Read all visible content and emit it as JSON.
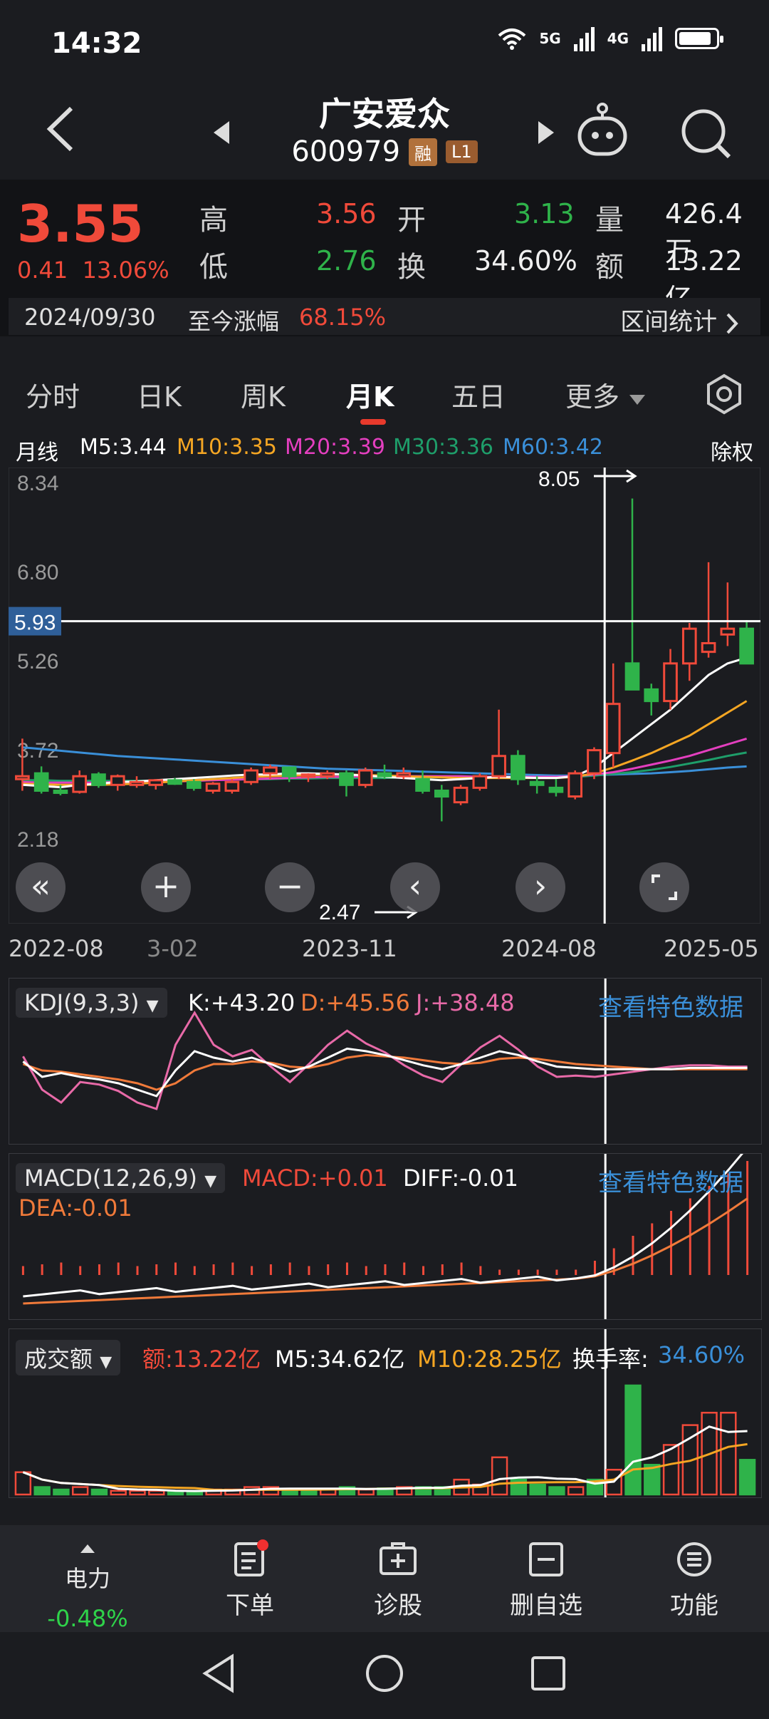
{
  "status": {
    "time": "14:32",
    "net1": "5G",
    "net2": "4G"
  },
  "header": {
    "name": "广安爱众",
    "code": "600979",
    "tag1": "融",
    "tag2": "L1"
  },
  "quote": {
    "price": "3.55",
    "change": "0.41",
    "change_pct": "13.06%",
    "high_label": "高",
    "high": "3.56",
    "low_label": "低",
    "low": "2.76",
    "open_label": "开",
    "open": "3.13",
    "turnover_label": "换",
    "turnover": "34.60%",
    "volume_label": "量",
    "volume": "426.4万",
    "amount_label": "额",
    "amount": "13.22亿",
    "date": "2024/09/30",
    "ytd_label": "至今涨幅",
    "ytd": "68.15%",
    "interval_label": "区间统计"
  },
  "tabs": [
    "分时",
    "日K",
    "周K",
    "月K",
    "五日",
    "更多"
  ],
  "ma": {
    "label": "月线",
    "m5": "M5:3.44",
    "m10": "M10:3.35",
    "m20": "M20:3.39",
    "m30": "M30:3.36",
    "m60": "M60:3.42",
    "fq": "除权"
  },
  "colors": {
    "up": "#f04a3a",
    "down": "#2fb34a",
    "m5": "#ffffff",
    "m10": "#f5a623",
    "m20": "#e43fbf",
    "m30": "#1e9e6a",
    "m60": "#3a8fd8"
  },
  "chart_data": {
    "type": "candlestick",
    "y_ticks": [
      "8.34",
      "6.80",
      "5.26",
      "3.72",
      "2.18"
    ],
    "ylim": [
      2.18,
      8.34
    ],
    "x_ticks": [
      "2022-08",
      "3-02",
      "2023-11",
      "2024-08",
      "2025-05"
    ],
    "crosshair_price": "5.93",
    "max_label": "8.05",
    "min_label": "2.47",
    "candles": [
      {
        "o": 3.2,
        "h": 3.9,
        "l": 3.0,
        "c": 3.25
      },
      {
        "o": 3.3,
        "h": 3.42,
        "l": 2.95,
        "c": 3.0
      },
      {
        "o": 3.0,
        "h": 3.1,
        "l": 2.92,
        "c": 2.97
      },
      {
        "o": 2.98,
        "h": 3.35,
        "l": 2.95,
        "c": 3.25
      },
      {
        "o": 3.28,
        "h": 3.32,
        "l": 3.05,
        "c": 3.1
      },
      {
        "o": 3.1,
        "h": 3.28,
        "l": 3.0,
        "c": 3.25
      },
      {
        "o": 3.1,
        "h": 3.25,
        "l": 3.05,
        "c": 3.15
      },
      {
        "o": 3.1,
        "h": 3.2,
        "l": 3.02,
        "c": 3.18
      },
      {
        "o": 3.18,
        "h": 3.22,
        "l": 3.1,
        "c": 3.12
      },
      {
        "o": 3.15,
        "h": 3.2,
        "l": 3.0,
        "c": 3.05
      },
      {
        "o": 3.0,
        "h": 3.15,
        "l": 2.95,
        "c": 3.12
      },
      {
        "o": 3.0,
        "h": 3.2,
        "l": 2.95,
        "c": 3.15
      },
      {
        "o": 3.15,
        "h": 3.4,
        "l": 3.1,
        "c": 3.35
      },
      {
        "o": 3.3,
        "h": 3.45,
        "l": 3.2,
        "c": 3.4
      },
      {
        "o": 3.4,
        "h": 3.42,
        "l": 3.15,
        "c": 3.25
      },
      {
        "o": 3.25,
        "h": 3.3,
        "l": 3.15,
        "c": 3.28
      },
      {
        "o": 3.25,
        "h": 3.35,
        "l": 3.2,
        "c": 3.3
      },
      {
        "o": 3.3,
        "h": 3.35,
        "l": 2.9,
        "c": 3.1
      },
      {
        "o": 3.1,
        "h": 3.4,
        "l": 3.05,
        "c": 3.35
      },
      {
        "o": 3.3,
        "h": 3.45,
        "l": 3.2,
        "c": 3.25
      },
      {
        "o": 3.25,
        "h": 3.4,
        "l": 3.2,
        "c": 3.3
      },
      {
        "o": 3.2,
        "h": 3.35,
        "l": 2.95,
        "c": 3.0
      },
      {
        "o": 3.0,
        "h": 3.1,
        "l": 2.47,
        "c": 2.9
      },
      {
        "o": 2.8,
        "h": 3.1,
        "l": 2.75,
        "c": 3.05
      },
      {
        "o": 3.05,
        "h": 3.3,
        "l": 3.0,
        "c": 3.25
      },
      {
        "o": 3.25,
        "h": 4.4,
        "l": 3.2,
        "c": 3.6
      },
      {
        "o": 3.6,
        "h": 3.7,
        "l": 3.1,
        "c": 3.2
      },
      {
        "o": 3.15,
        "h": 3.25,
        "l": 2.95,
        "c": 3.1
      },
      {
        "o": 3.05,
        "h": 3.2,
        "l": 2.9,
        "c": 2.98
      },
      {
        "o": 2.9,
        "h": 3.35,
        "l": 2.85,
        "c": 3.3
      },
      {
        "o": 3.3,
        "h": 3.75,
        "l": 3.2,
        "c": 3.7
      },
      {
        "o": 3.65,
        "h": 5.2,
        "l": 3.4,
        "c": 4.5
      },
      {
        "o": 5.2,
        "h": 8.05,
        "l": 4.8,
        "c": 4.75
      },
      {
        "o": 4.75,
        "h": 4.85,
        "l": 4.3,
        "c": 4.55
      },
      {
        "o": 4.55,
        "h": 5.45,
        "l": 4.4,
        "c": 5.2
      },
      {
        "o": 5.2,
        "h": 5.9,
        "l": 4.9,
        "c": 5.8
      },
      {
        "o": 5.4,
        "h": 6.95,
        "l": 5.3,
        "c": 5.55
      },
      {
        "o": 5.7,
        "h": 6.6,
        "l": 5.5,
        "c": 5.8
      },
      {
        "o": 5.8,
        "h": 5.95,
        "l": 5.2,
        "c": 5.2
      }
    ],
    "ma": {
      "m5": [
        3.1,
        3.08,
        3.06,
        3.1,
        3.12,
        3.15,
        3.16,
        3.18,
        3.2,
        3.22,
        3.24,
        3.26,
        3.28,
        3.28,
        3.3,
        3.3,
        3.29,
        3.28,
        3.26,
        3.24,
        3.22,
        3.2,
        3.18,
        3.2,
        3.22,
        3.24,
        3.23,
        3.22,
        3.22,
        3.25,
        3.4,
        3.65,
        3.9,
        4.15,
        4.4,
        4.7,
        5.0,
        5.2,
        5.3
      ],
      "m10": [
        3.12,
        3.11,
        3.1,
        3.1,
        3.1,
        3.11,
        3.12,
        3.14,
        3.16,
        3.18,
        3.2,
        3.22,
        3.24,
        3.25,
        3.26,
        3.27,
        3.28,
        3.28,
        3.27,
        3.26,
        3.25,
        3.24,
        3.23,
        3.22,
        3.22,
        3.22,
        3.22,
        3.22,
        3.22,
        3.24,
        3.3,
        3.4,
        3.52,
        3.65,
        3.8,
        3.95,
        4.15,
        4.35,
        4.55
      ],
      "m20": [
        3.15,
        3.14,
        3.14,
        3.14,
        3.14,
        3.15,
        3.15,
        3.16,
        3.16,
        3.17,
        3.18,
        3.19,
        3.2,
        3.21,
        3.22,
        3.23,
        3.24,
        3.24,
        3.25,
        3.25,
        3.25,
        3.25,
        3.25,
        3.25,
        3.24,
        3.24,
        3.24,
        3.24,
        3.24,
        3.25,
        3.28,
        3.32,
        3.38,
        3.45,
        3.52,
        3.6,
        3.7,
        3.8,
        3.9
      ],
      "m30": [
        3.18,
        3.18,
        3.17,
        3.17,
        3.17,
        3.17,
        3.17,
        3.17,
        3.18,
        3.18,
        3.19,
        3.19,
        3.2,
        3.2,
        3.21,
        3.21,
        3.22,
        3.22,
        3.22,
        3.22,
        3.23,
        3.23,
        3.23,
        3.23,
        3.23,
        3.23,
        3.23,
        3.23,
        3.23,
        3.24,
        3.26,
        3.29,
        3.32,
        3.36,
        3.41,
        3.47,
        3.53,
        3.6,
        3.66
      ],
      "m60": [
        3.75,
        3.72,
        3.69,
        3.66,
        3.63,
        3.6,
        3.58,
        3.56,
        3.54,
        3.52,
        3.5,
        3.48,
        3.46,
        3.44,
        3.42,
        3.4,
        3.38,
        3.37,
        3.36,
        3.35,
        3.34,
        3.33,
        3.32,
        3.31,
        3.3,
        3.29,
        3.28,
        3.27,
        3.26,
        3.26,
        3.27,
        3.28,
        3.29,
        3.3,
        3.32,
        3.34,
        3.37,
        3.4,
        3.42
      ]
    },
    "kdj": {
      "k": [
        52,
        40,
        43,
        40,
        38,
        35,
        30,
        25,
        45,
        60,
        55,
        52,
        55,
        50,
        44,
        48,
        55,
        62,
        60,
        57,
        53,
        49,
        46,
        50,
        55,
        60,
        57,
        52,
        48,
        47,
        46,
        46,
        46,
        46,
        46,
        47,
        47,
        47,
        47
      ],
      "d": [
        50,
        45,
        44,
        42,
        40,
        38,
        35,
        30,
        35,
        45,
        50,
        50,
        52,
        51,
        48,
        47,
        50,
        55,
        57,
        56,
        55,
        53,
        51,
        50,
        51,
        54,
        55,
        54,
        52,
        50,
        49,
        48,
        47,
        46,
        46,
        46,
        46,
        46,
        46
      ],
      "j": [
        56,
        30,
        20,
        36,
        34,
        29,
        20,
        15,
        65,
        90,
        65,
        56,
        61,
        48,
        36,
        50,
        65,
        76,
        66,
        59,
        49,
        41,
        36,
        50,
        63,
        72,
        61,
        48,
        40,
        41,
        40,
        42,
        44,
        46,
        48,
        49,
        49,
        48,
        48
      ]
    },
    "volume": [
      {
        "v": 0.9,
        "up": true
      },
      {
        "v": 0.3,
        "up": false
      },
      {
        "v": 0.2,
        "up": false
      },
      {
        "v": 0.3,
        "up": true
      },
      {
        "v": 0.2,
        "up": false
      },
      {
        "v": 0.15,
        "up": true
      },
      {
        "v": 0.15,
        "up": true
      },
      {
        "v": 0.15,
        "up": true
      },
      {
        "v": 0.1,
        "up": false
      },
      {
        "v": 0.15,
        "up": false
      },
      {
        "v": 0.2,
        "up": true
      },
      {
        "v": 0.2,
        "up": true
      },
      {
        "v": 0.3,
        "up": true
      },
      {
        "v": 0.3,
        "up": true
      },
      {
        "v": 0.2,
        "up": false
      },
      {
        "v": 0.2,
        "up": false
      },
      {
        "v": 0.2,
        "up": true
      },
      {
        "v": 0.3,
        "up": false
      },
      {
        "v": 0.2,
        "up": true
      },
      {
        "v": 0.25,
        "up": false
      },
      {
        "v": 0.3,
        "up": true
      },
      {
        "v": 0.3,
        "up": false
      },
      {
        "v": 0.3,
        "up": false
      },
      {
        "v": 0.6,
        "up": true
      },
      {
        "v": 0.4,
        "up": true
      },
      {
        "v": 1.5,
        "up": true
      },
      {
        "v": 0.6,
        "up": false
      },
      {
        "v": 0.4,
        "up": false
      },
      {
        "v": 0.3,
        "up": false
      },
      {
        "v": 0.3,
        "up": true
      },
      {
        "v": 0.6,
        "up": false
      },
      {
        "v": 1.0,
        "up": true
      },
      {
        "v": 4.4,
        "up": false
      },
      {
        "v": 1.2,
        "up": false
      },
      {
        "v": 2.0,
        "up": true
      },
      {
        "v": 2.8,
        "up": true
      },
      {
        "v": 3.3,
        "up": true
      },
      {
        "v": 3.3,
        "up": true
      },
      {
        "v": 1.4,
        "up": false
      }
    ]
  },
  "kdj_panel": {
    "title": "KDJ(9,3,3)",
    "k": "K:+43.20",
    "d": "D:+45.56",
    "j": "J:+38.48",
    "link": "查看特色数据"
  },
  "macd_panel": {
    "title": "MACD(12,26,9)",
    "macd": "MACD:+0.01",
    "diff": "DIFF:-0.01",
    "dea": "DEA:-0.01",
    "link": "查看特色数据"
  },
  "vol_panel": {
    "title": "成交额",
    "amount": "额:13.22亿",
    "m5": "M5:34.62亿",
    "m10": "M10:28.25亿",
    "turnover_label": "换手率:",
    "turnover": "34.60%"
  },
  "bottom": {
    "sector_name": "电力",
    "sector_change": "-0.48%",
    "order": "下单",
    "diagnose": "诊股",
    "remove": "删自选",
    "func": "功能"
  }
}
